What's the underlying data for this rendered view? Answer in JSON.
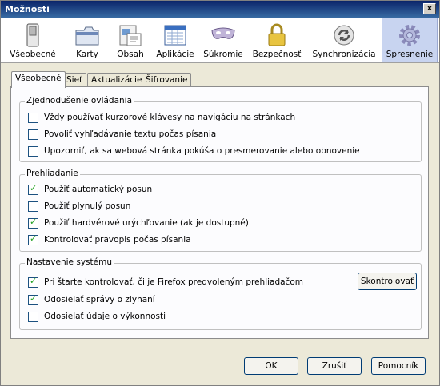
{
  "window": {
    "title": "Možnosti",
    "close_symbol": "x"
  },
  "panes": [
    {
      "label": "Všeobecné",
      "icon": "general-switch-icon"
    },
    {
      "label": "Karty",
      "icon": "tabs-icon"
    },
    {
      "label": "Obsah",
      "icon": "content-icon"
    },
    {
      "label": "Aplikácie",
      "icon": "applications-icon"
    },
    {
      "label": "Súkromie",
      "icon": "privacy-mask-icon"
    },
    {
      "label": "Bezpečnosť",
      "icon": "security-lock-icon"
    },
    {
      "label": "Synchronizácia",
      "icon": "sync-icon"
    },
    {
      "label": "Spresnenie",
      "icon": "advanced-gear-icon",
      "selected": true
    }
  ],
  "tabs": [
    {
      "label": "Všeobecné",
      "active": true
    },
    {
      "label": "Sieť"
    },
    {
      "label": "Aktualizácie"
    },
    {
      "label": "Šifrovanie"
    }
  ],
  "accessibility": {
    "title": "Zjednodušenie ovládania",
    "options": [
      {
        "label": "Vždy používať kurzorové klávesy na navigáciu na stránkach",
        "checked": false
      },
      {
        "label": "Povoliť vyhľadávanie textu počas písania",
        "checked": false
      },
      {
        "label": "Upozorniť, ak sa webová stránka pokúša o presmerovanie alebo obnovenie",
        "checked": false
      }
    ]
  },
  "browsing": {
    "title": "Prehliadanie",
    "options": [
      {
        "label": "Použiť automatický posun",
        "checked": true
      },
      {
        "label": "Použiť plynulý posun",
        "checked": false
      },
      {
        "label": "Použiť hardvérové urýchľovanie (ak je dostupné)",
        "checked": true
      },
      {
        "label": "Kontrolovať pravopis počas písania",
        "checked": true
      }
    ]
  },
  "system": {
    "title": "Nastavenie systému",
    "options": [
      {
        "label": "Pri štarte kontrolovať, či je Firefox predvoleným prehliadačom",
        "checked": true
      },
      {
        "label": "Odosielať správy o zlyhaní",
        "checked": true
      },
      {
        "label": "Odosielať údaje o výkonnosti",
        "checked": false
      }
    ],
    "check_now_label": "Skontrolovať"
  },
  "buttons": {
    "ok": "OK",
    "cancel": "Zrušiť",
    "help": "Pomocník"
  },
  "check_mark": "✓",
  "colors": {
    "titlebar": "#0a246a",
    "selected_pane": "#c8d4f0",
    "check": "#21a121"
  }
}
